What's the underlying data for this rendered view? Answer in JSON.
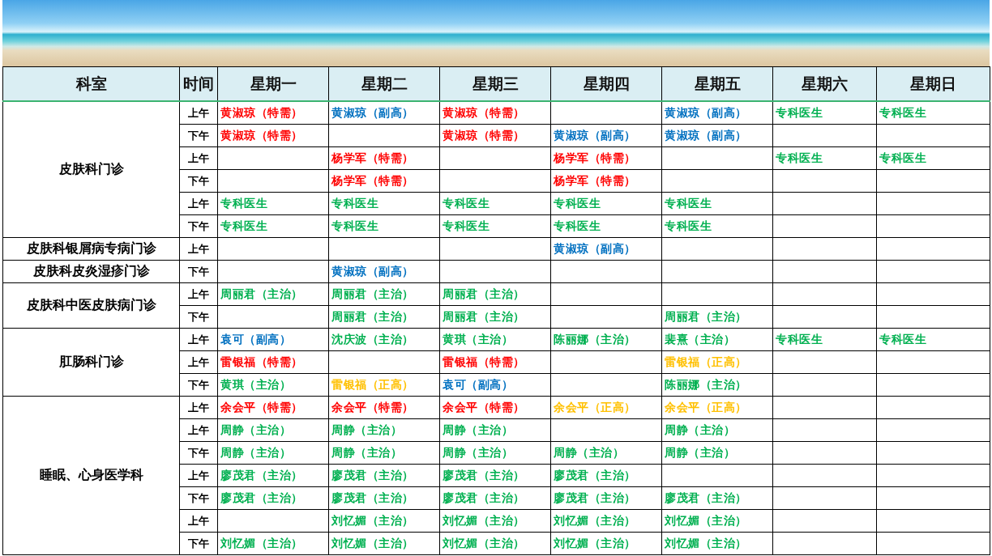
{
  "columns": [
    "科室",
    "时间",
    "星期一",
    "星期二",
    "星期三",
    "星期四",
    "星期五",
    "星期六",
    "星期日"
  ],
  "departments": [
    {
      "name": "皮肤科门诊",
      "slots": [
        {
          "time": "上午",
          "cells": [
            {
              "text": "黄淑琼（特需）",
              "color": "#ff0000"
            },
            {
              "text": "黄淑琼（副高）",
              "color": "#0070c0"
            },
            {
              "text": "黄淑琼（特需）",
              "color": "#ff0000"
            },
            null,
            {
              "text": "黄淑琼（副高）",
              "color": "#0070c0"
            },
            {
              "text": "专科医生",
              "color": "#00b050"
            },
            {
              "text": "专科医生",
              "color": "#00b050"
            }
          ]
        },
        {
          "time": "下午",
          "cells": [
            {
              "text": "黄淑琼（特需）",
              "color": "#ff0000"
            },
            null,
            {
              "text": "黄淑琼（特需）",
              "color": "#ff0000"
            },
            {
              "text": "黄淑琼（副高）",
              "color": "#0070c0"
            },
            {
              "text": "黄淑琼（副高）",
              "color": "#0070c0"
            },
            null,
            null
          ]
        },
        {
          "time": "上午",
          "cells": [
            null,
            {
              "text": "杨学军（特需）",
              "color": "#ff0000"
            },
            null,
            {
              "text": "杨学军（特需）",
              "color": "#ff0000"
            },
            null,
            {
              "text": "专科医生",
              "color": "#00b050"
            },
            {
              "text": "专科医生",
              "color": "#00b050"
            }
          ]
        },
        {
          "time": "下午",
          "cells": [
            null,
            {
              "text": "杨学军（特需）",
              "color": "#ff0000"
            },
            null,
            {
              "text": "杨学军（特需）",
              "color": "#ff0000"
            },
            null,
            null,
            null
          ]
        },
        {
          "time": "上午",
          "cells": [
            {
              "text": "专科医生",
              "color": "#00b050"
            },
            {
              "text": "专科医生",
              "color": "#00b050"
            },
            {
              "text": "专科医生",
              "color": "#00b050"
            },
            {
              "text": "专科医生",
              "color": "#00b050"
            },
            {
              "text": "专科医生",
              "color": "#00b050"
            },
            null,
            null
          ]
        },
        {
          "time": "下午",
          "cells": [
            {
              "text": "专科医生",
              "color": "#00b050"
            },
            {
              "text": "专科医生",
              "color": "#00b050"
            },
            {
              "text": "专科医生",
              "color": "#00b050"
            },
            {
              "text": "专科医生",
              "color": "#00b050"
            },
            {
              "text": "专科医生",
              "color": "#00b050"
            },
            null,
            null
          ]
        }
      ]
    },
    {
      "name": "皮肤科银屑病专病门诊",
      "slots": [
        {
          "time": "上午",
          "cells": [
            null,
            null,
            null,
            {
              "text": "黄淑琼（副高）",
              "color": "#0070c0"
            },
            null,
            null,
            null
          ]
        }
      ]
    },
    {
      "name": "皮肤科皮炎湿疹门诊",
      "slots": [
        {
          "time": "下午",
          "cells": [
            null,
            {
              "text": "黄淑琼（副高）",
              "color": "#0070c0"
            },
            null,
            null,
            null,
            null,
            null
          ]
        }
      ]
    },
    {
      "name": "皮肤科中医皮肤病门诊",
      "slots": [
        {
          "time": "上午",
          "cells": [
            {
              "text": "周丽君（主治）",
              "color": "#00b050"
            },
            {
              "text": "周丽君（主治）",
              "color": "#00b050"
            },
            {
              "text": "周丽君（主治）",
              "color": "#00b050"
            },
            null,
            null,
            null,
            null
          ]
        },
        {
          "time": "下午",
          "cells": [
            null,
            {
              "text": "周丽君（主治）",
              "color": "#00b050"
            },
            {
              "text": "周丽君（主治）",
              "color": "#00b050"
            },
            null,
            {
              "text": "周丽君（主治）",
              "color": "#00b050"
            },
            null,
            null
          ]
        }
      ]
    },
    {
      "name": "肛肠科门诊",
      "slots": [
        {
          "time": "上午",
          "cells": [
            {
              "text": "袁可（副高）",
              "color": "#0070c0"
            },
            {
              "text": "沈庆波（主治）",
              "color": "#00b050"
            },
            {
              "text": "黄琪（主治）",
              "color": "#00b050"
            },
            {
              "text": "陈丽娜（主治）",
              "color": "#00b050"
            },
            {
              "text": "裴熹（主治）",
              "color": "#00b050"
            },
            {
              "text": "专科医生",
              "color": "#00b050"
            },
            {
              "text": "专科医生",
              "color": "#00b050"
            }
          ]
        },
        {
          "time": "上午",
          "cells": [
            {
              "text": "雷银福（特需）",
              "color": "#ff0000"
            },
            null,
            {
              "text": "雷银福（特需）",
              "color": "#ff0000"
            },
            null,
            {
              "text": "雷银福（正高）",
              "color": "#ffc000"
            },
            null,
            null
          ]
        },
        {
          "time": "下午",
          "cells": [
            {
              "text": "黄琪（主治）",
              "color": "#00b050"
            },
            {
              "text": "雷银福（正高）",
              "color": "#ffc000"
            },
            {
              "text": "袁可（副高）",
              "color": "#0070c0"
            },
            null,
            {
              "text": "陈丽娜（主治）",
              "color": "#00b050"
            },
            null,
            null
          ]
        }
      ]
    },
    {
      "name": "睡眠、心身医学科",
      "slots": [
        {
          "time": "上午",
          "cells": [
            {
              "text": "余会平（特需）",
              "color": "#ff0000"
            },
            {
              "text": "余会平（特需）",
              "color": "#ff0000"
            },
            {
              "text": "余会平（特需）",
              "color": "#ff0000"
            },
            {
              "text": "余会平（正高）",
              "color": "#ffc000"
            },
            {
              "text": "余会平（正高）",
              "color": "#ffc000"
            },
            null,
            null
          ]
        },
        {
          "time": "上午",
          "cells": [
            {
              "text": "周静（主治）",
              "color": "#00b050"
            },
            {
              "text": "周静（主治）",
              "color": "#00b050"
            },
            {
              "text": "周静（主治）",
              "color": "#00b050"
            },
            null,
            {
              "text": "周静（主治）",
              "color": "#00b050"
            },
            null,
            null
          ]
        },
        {
          "time": "下午",
          "cells": [
            {
              "text": "周静（主治）",
              "color": "#00b050"
            },
            {
              "text": "周静（主治）",
              "color": "#00b050"
            },
            {
              "text": "周静（主治）",
              "color": "#00b050"
            },
            {
              "text": "周静（主治）",
              "color": "#00b050"
            },
            {
              "text": "周静（主治）",
              "color": "#00b050"
            },
            null,
            null
          ]
        },
        {
          "time": "上午",
          "cells": [
            {
              "text": "廖茂君（主治）",
              "color": "#00b050"
            },
            {
              "text": "廖茂君（主治）",
              "color": "#00b050"
            },
            {
              "text": "廖茂君（主治）",
              "color": "#00b050"
            },
            {
              "text": "廖茂君（主治）",
              "color": "#00b050"
            },
            null,
            null,
            null
          ]
        },
        {
          "time": "下午",
          "cells": [
            {
              "text": "廖茂君（主治）",
              "color": "#00b050"
            },
            {
              "text": "廖茂君（主治）",
              "color": "#00b050"
            },
            {
              "text": "廖茂君（主治）",
              "color": "#00b050"
            },
            {
              "text": "廖茂君（主治）",
              "color": "#00b050"
            },
            {
              "text": "廖茂君（主治）",
              "color": "#00b050"
            },
            null,
            null
          ]
        },
        {
          "time": "上午",
          "cells": [
            null,
            {
              "text": "刘忆媚（主治）",
              "color": "#00b050"
            },
            {
              "text": "刘忆媚（主治）",
              "color": "#00b050"
            },
            {
              "text": "刘忆媚（主治）",
              "color": "#00b050"
            },
            {
              "text": "刘忆媚（主治）",
              "color": "#00b050"
            },
            null,
            null
          ]
        },
        {
          "time": "下午",
          "cells": [
            {
              "text": "刘忆媚（主治）",
              "color": "#00b050"
            },
            {
              "text": "刘忆媚（主治）",
              "color": "#00b050"
            },
            {
              "text": "刘忆媚（主治）",
              "color": "#00b050"
            },
            {
              "text": "刘忆媚（主治）",
              "color": "#00b050"
            },
            {
              "text": "刘忆媚（主治）",
              "color": "#00b050"
            },
            null,
            null
          ]
        }
      ]
    }
  ]
}
